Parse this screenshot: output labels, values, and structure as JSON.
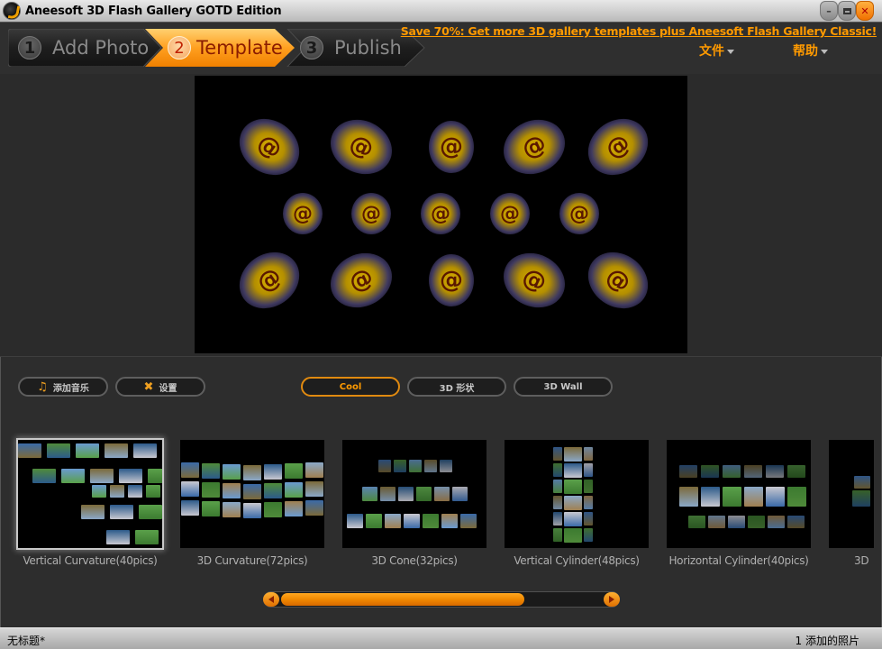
{
  "window": {
    "title": "Aneesoft 3D Flash Gallery GOTD Edition",
    "controls": [
      "minimize",
      "maximize",
      "close"
    ]
  },
  "steps": [
    {
      "num": "1",
      "label": "Add Photo",
      "active": false
    },
    {
      "num": "2",
      "label": "Template",
      "active": true
    },
    {
      "num": "3",
      "label": "Publish",
      "active": false
    }
  ],
  "promo": {
    "text": "Save 70%: Get more 3D gallery templates plus Aneesoft Flash Gallery Classic!"
  },
  "menu": [
    {
      "label": "文件"
    },
    {
      "label": "帮助"
    }
  ],
  "preview": {
    "glyph": "@"
  },
  "toolbar": {
    "add_music_label": "添加音乐",
    "settings_label": "设置"
  },
  "categories": [
    {
      "label": "Cool",
      "active": true
    },
    {
      "label": "3D 形状",
      "active": false
    },
    {
      "label": "3D Wall",
      "active": false
    }
  ],
  "templates": [
    {
      "label": "Vertical Curvature(40pics)",
      "selected": true
    },
    {
      "label": "3D Curvature(72pics)",
      "selected": false
    },
    {
      "label": "3D Cone(32pics)",
      "selected": false
    },
    {
      "label": "Vertical Cylinder(48pics)",
      "selected": false
    },
    {
      "label": "Horizontal Cylinder(40pics)",
      "selected": false
    },
    {
      "label": "3D",
      "selected": false
    }
  ],
  "scrollbar": {
    "position_fraction": 0.0,
    "visible_fraction": 0.7
  },
  "status": {
    "document": "无标题*",
    "photo_count": "1 添加的照片"
  },
  "colors": {
    "accent": "#ff9a00",
    "background": "#2d2d2d",
    "title_bar": "#c8c8c8"
  }
}
